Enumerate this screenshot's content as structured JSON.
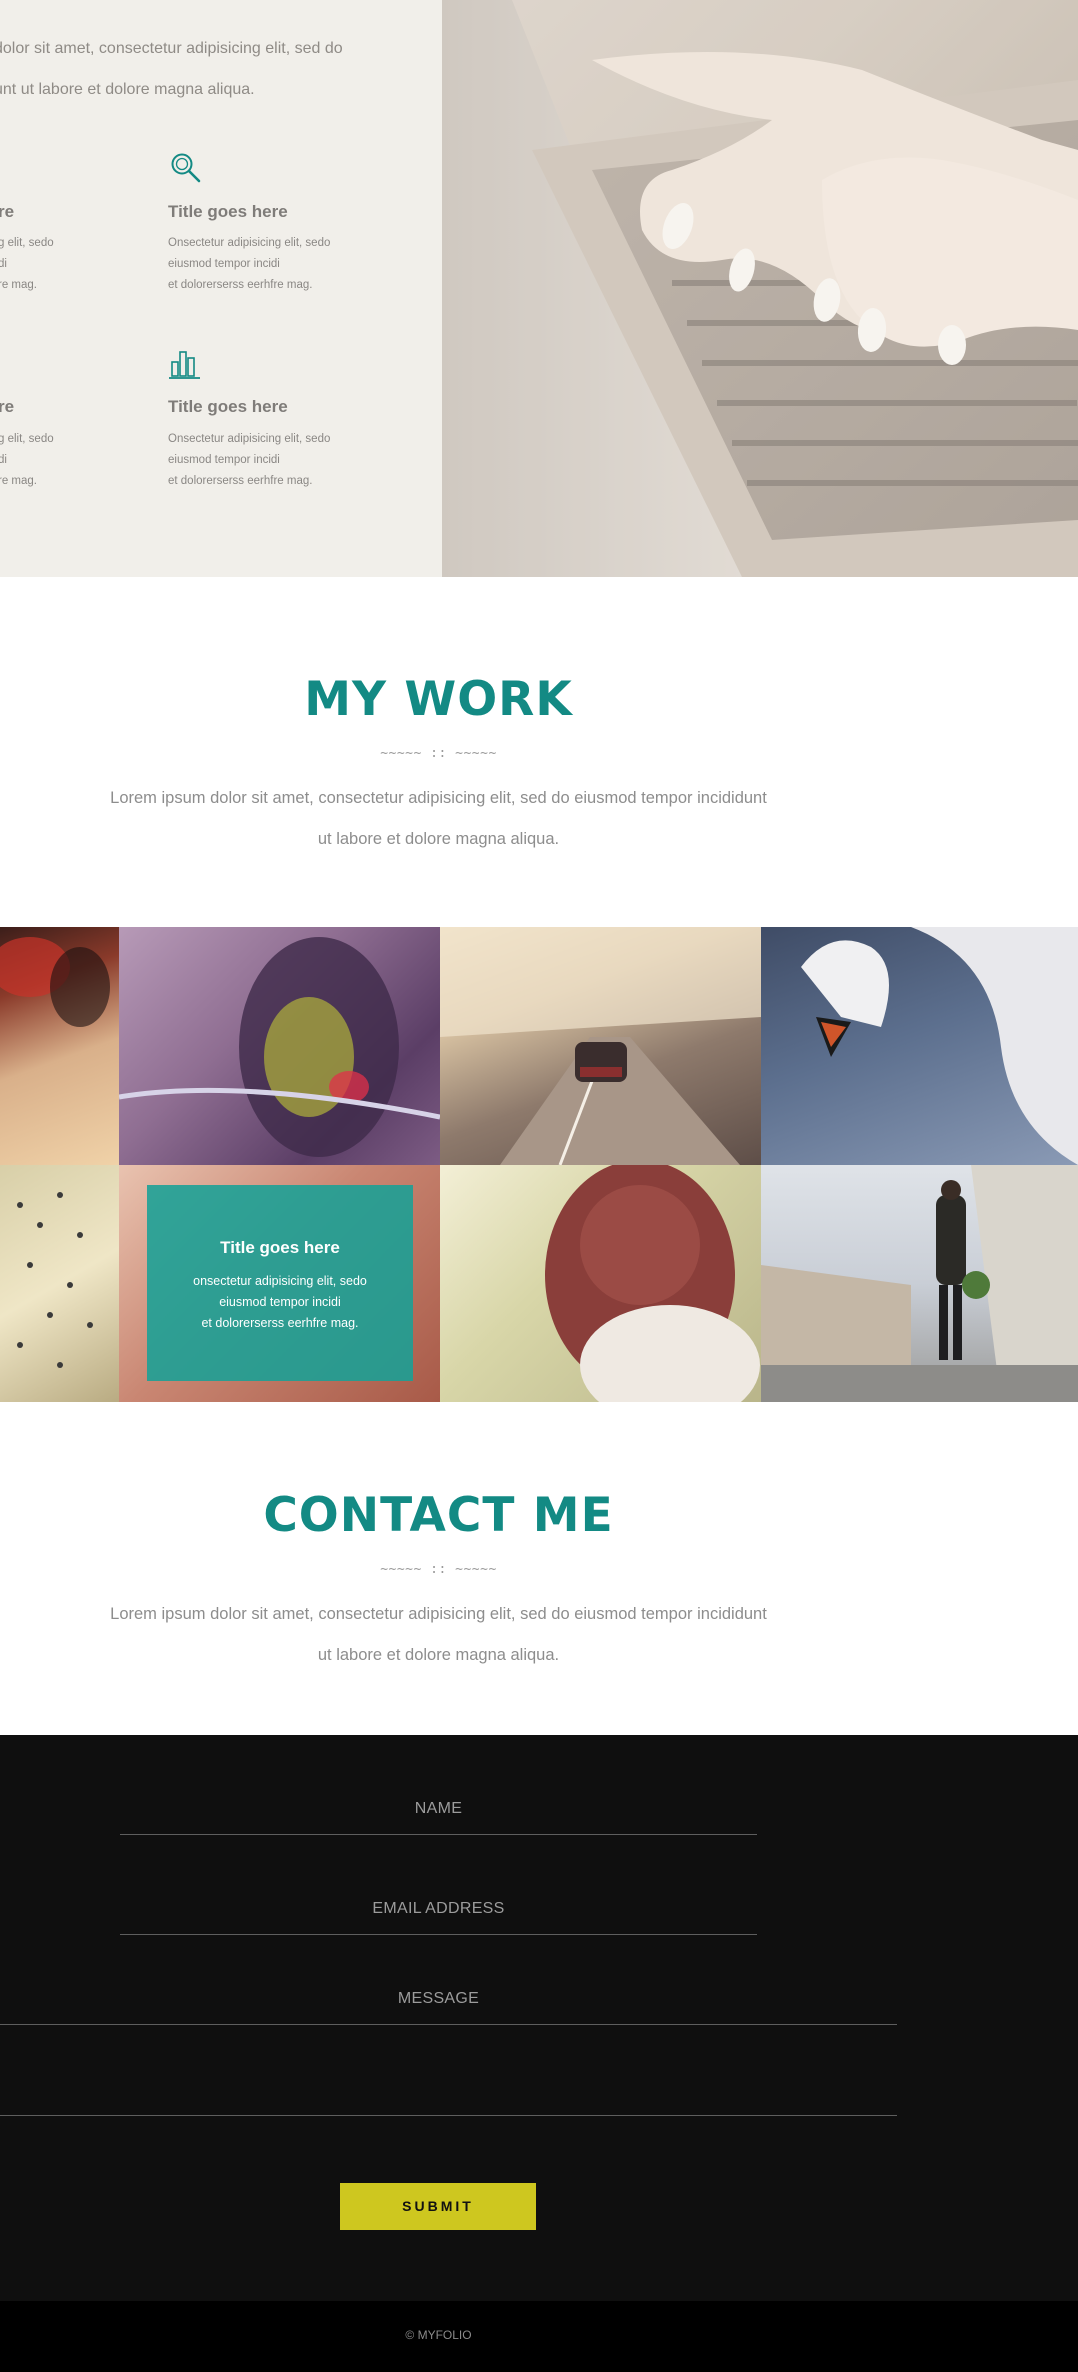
{
  "features": {
    "intro_line1": "dolor sit amet, consectetur adipisicing elit, sed do",
    "intro_line2": "unt ut labore et dolore magna aliqua.",
    "items": [
      {
        "icon": "magnifier-icon",
        "title": "Title goes here",
        "desc_line1": "Onsectetur adipisicing elit, sedo",
        "desc_line2": "eiusmod tempor incidi",
        "desc_line3": "et dolorerserss eerhfre mag."
      },
      {
        "icon": "bar-chart-icon",
        "title": "Title goes here",
        "desc_line1": "Onsectetur adipisicing elit, sedo",
        "desc_line2": "eiusmod tempor incidi",
        "desc_line3": "et dolorerserss eerhfre mag."
      }
    ],
    "partial_items": [
      {
        "title_tail": "re",
        "desc_line1": "g elit, sedo",
        "desc_line2": "di",
        "desc_line3": "re mag."
      },
      {
        "title_tail": "re",
        "desc_line1": "g elit, sedo",
        "desc_line2": "di",
        "desc_line3": "re mag."
      }
    ]
  },
  "my_work": {
    "title": "MY WORK",
    "divider": "~~~~~ :: ~~~~~",
    "desc_line1": "Lorem ipsum dolor sit amet, consectetur adipisicing elit, sed do eiusmod tempor incididunt",
    "desc_line2": "ut labore et dolore magna aliqua."
  },
  "gallery": {
    "overlay": {
      "title": "Title goes here",
      "desc_line1": "onsectetur adipisicing elit, sedo",
      "desc_line2": "eiusmod tempor incidi",
      "desc_line3": "et dolorerserss eerhfre mag."
    }
  },
  "contact": {
    "title": "CONTACT ME",
    "divider": "~~~~~ :: ~~~~~",
    "desc_line1": "Lorem ipsum dolor sit amet, consectetur adipisicing elit, sed do eiusmod tempor incididunt",
    "desc_line2": "ut labore et dolore magna aliqua.",
    "name_placeholder": "NAME",
    "email_placeholder": "EMAIL ADDRESS",
    "message_placeholder": "MESSAGE",
    "submit_label": "SUBMIT"
  },
  "footer": {
    "copyright": "© MYFOLIO"
  },
  "colors": {
    "accent": "#138a84",
    "submit": "#cec71f",
    "dark_bg": "#0f0f0f"
  }
}
